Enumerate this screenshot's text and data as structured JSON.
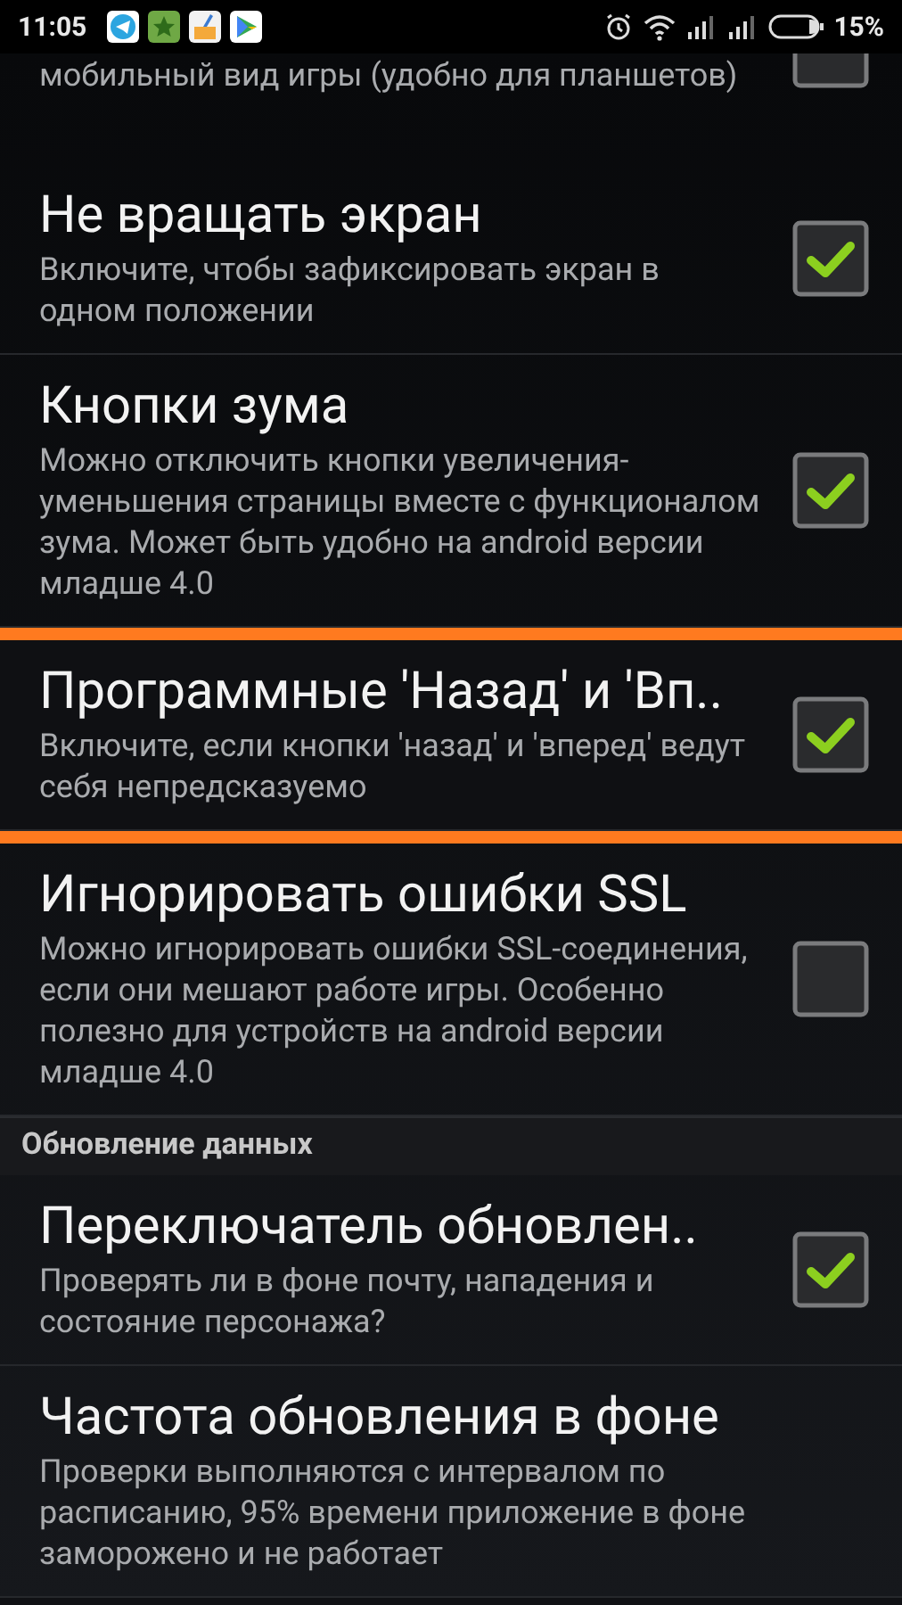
{
  "status_bar": {
    "time": "11:05",
    "battery": "15%"
  },
  "items": [
    {
      "kind": "checkbox",
      "description": "мобильный вид игры (удобно для планшетов)",
      "checked": false,
      "highlighted": false
    },
    {
      "kind": "checkbox",
      "title": "Не вращать экран",
      "description": "Включите, чтобы зафиксировать экран в одном положении",
      "checked": true,
      "highlighted": false
    },
    {
      "kind": "checkbox",
      "title": "Кнопки зума",
      "description": "Можно отключить кнопки увеличения-уменьшения страницы вместе с функционалом зума. Может быть удобно на android версии младше 4.0",
      "checked": true,
      "highlighted": false
    },
    {
      "kind": "checkbox",
      "title": "Программные 'Назад' и 'Вп..",
      "description": "Включите, если кнопки 'назад' и 'вперед' ведут себя непредсказуемо",
      "checked": true,
      "highlighted": true
    },
    {
      "kind": "checkbox",
      "title": "Игнорировать ошибки SSL",
      "description": "Можно игнорировать ошибки SSL-соединения, если они мешают работе игры. Особенно полезно для устройств на android версии младше 4.0",
      "checked": false,
      "highlighted": false
    },
    {
      "kind": "header",
      "title": "Обновление данных"
    },
    {
      "kind": "checkbox",
      "title": "Переключатель обновлен..",
      "description": "Проверять ли в фоне почту, нападения и состояние персонажа?",
      "checked": true,
      "highlighted": false
    },
    {
      "kind": "plain",
      "title": "Частота обновления в фоне",
      "description": "Проверки выполняются с интервалом по расписанию, 95% времени приложение в фоне заморожено и не работает",
      "highlighted": false
    }
  ]
}
